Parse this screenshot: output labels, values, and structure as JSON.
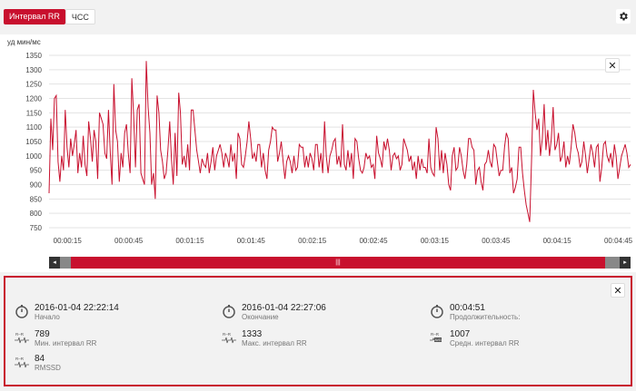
{
  "tabs": {
    "rr_label": "Интервал RR",
    "hr_label": "ЧСС"
  },
  "colors": {
    "accent": "#c8102e",
    "line": "#c8102e"
  },
  "chart_data": {
    "type": "line",
    "ylabel": "уд мин/мс",
    "ylim": [
      750,
      1350
    ],
    "yticks": [
      1350,
      1300,
      1250,
      1200,
      1150,
      1100,
      1050,
      1000,
      950,
      900,
      850,
      800,
      750
    ],
    "xticks": [
      "00:00:15",
      "00:00:45",
      "00:01:15",
      "00:01:45",
      "00:02:15",
      "00:02:45",
      "00:03:15",
      "00:03:45",
      "00:04:15",
      "00:04:45"
    ],
    "xlim_seconds": [
      6,
      291
    ],
    "grid": true,
    "series": [
      {
        "values": [
          870,
          1130,
          1020,
          1200,
          1210,
          980,
          910,
          1000,
          950,
          1160,
          1030,
          960,
          1060,
          1000,
          1040,
          1090,
          940,
          1010,
          960,
          1070,
          970,
          930,
          1120,
          1060,
          980,
          1090,
          1050,
          920,
          1150,
          1130,
          1110,
          1010,
          990,
          1160,
          1010,
          900,
          1250,
          1090,
          1050,
          910,
          1010,
          960,
          1080,
          1110,
          1010,
          940,
          1270,
          1140,
          960,
          1160,
          1180,
          940,
          920,
          900,
          1330,
          1170,
          1080,
          900,
          940,
          850,
          1210,
          1150,
          1020,
          980,
          920,
          940,
          1020,
          1120,
          990,
          900,
          1080,
          930,
          1220,
          1150,
          970,
          1000,
          960,
          1040,
          950,
          1160,
          1160,
          1090,
          1020,
          980,
          940,
          990,
          970,
          960,
          1010,
          940,
          980,
          1030,
          950,
          1000,
          1020,
          1040,
          1010,
          960,
          1010,
          990,
          960,
          1040,
          980,
          1010,
          920,
          1080,
          1060,
          970,
          960,
          1000,
          1050,
          1120,
          1060,
          990,
          1010,
          980,
          1040,
          1040,
          960,
          1010,
          950,
          920,
          1020,
          1050,
          1100,
          1090,
          1090,
          980,
          1010,
          1050,
          980,
          920,
          980,
          1000,
          980,
          940,
          1000,
          950,
          960,
          1040,
          1030,
          1030,
          960,
          1000,
          960,
          1010,
          990,
          950,
          1040,
          1040,
          960,
          1010,
          940,
          1120,
          1000,
          940,
          1000,
          1020,
          1050,
          1060,
          970,
          1000,
          960,
          1110,
          970,
          950,
          1020,
          960,
          1010,
          920,
          1060,
          1050,
          990,
          950,
          940,
          960,
          1010,
          990,
          1000,
          960,
          970,
          920,
          1070,
          1010,
          990,
          960,
          1050,
          1020,
          1060,
          1020,
          950,
          1000,
          1010,
          990,
          1000,
          950,
          970,
          1060,
          1040,
          1020,
          980,
          1000,
          950,
          980,
          920,
          1000,
          950,
          990,
          960,
          960,
          940,
          1060,
          960,
          940,
          930,
          1100,
          1060,
          950,
          1020,
          940,
          1010,
          970,
          900,
          880,
          1000,
          1030,
          950,
          960,
          1030,
          1000,
          950,
          920,
          970,
          1060,
          1060,
          1030,
          1020,
          900,
          950,
          960,
          910,
          880,
          970,
          980,
          1020,
          980,
          960,
          1040,
          1030,
          980,
          930,
          950,
          950,
          1030,
          1080,
          1060,
          940,
          960,
          870,
          890,
          920,
          1030,
          1030,
          940,
          880,
          830,
          800,
          770,
          980,
          1230,
          1150,
          1090,
          1130,
          1000,
          1060,
          1180,
          1020,
          1090,
          1000,
          1060,
          1170,
          1020,
          1040,
          1080,
          980,
          1000,
          1050,
          960,
          1000,
          970,
          1030,
          1110,
          1080,
          1030,
          1010,
          960,
          980,
          1050,
          1000,
          940,
          990,
          1040,
          1010,
          960,
          1030,
          1040,
          910,
          960,
          1040,
          1050,
          1000,
          980,
          1010,
          960,
          1040,
          1000,
          920,
          960,
          1000,
          1020,
          1040,
          1010,
          960,
          970
        ]
      }
    ]
  },
  "stats": {
    "start": {
      "value": "2016-01-04 22:22:14",
      "label": "Начало"
    },
    "end": {
      "value": "2016-01-04 22:27:06",
      "label": "Окончание"
    },
    "duration": {
      "value": "00:04:51",
      "label": "Продолжительность:"
    },
    "min_rr": {
      "value": "789",
      "label": "Мин. интервал RR",
      "icon_text": "MIN"
    },
    "max_rr": {
      "value": "1333",
      "label": "Макс. интервал RR",
      "icon_text": "MAX"
    },
    "avg_rr": {
      "value": "1007",
      "label": "Средн. интервал RR",
      "icon_text": "AVG"
    },
    "rmssd": {
      "value": "84",
      "label": "RMSSD"
    }
  },
  "scroller": {
    "thumb_label": "|||",
    "left_arrow": "◂",
    "right_arrow": "▸"
  }
}
